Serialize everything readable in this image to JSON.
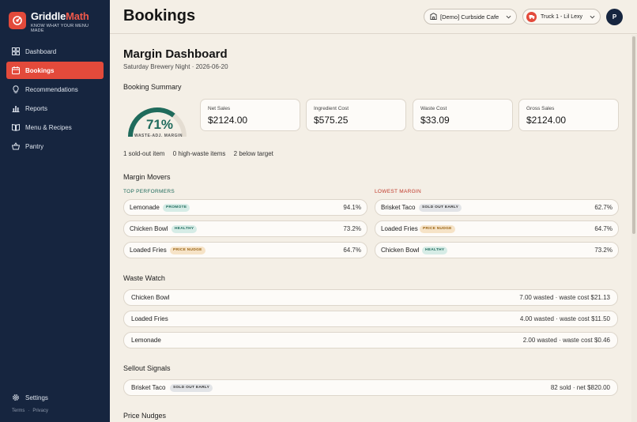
{
  "brand": {
    "name_part1": "Griddle",
    "name_part2": "Math",
    "tagline": "KNOW WHAT YOUR MENU MADE",
    "accent_color": "#e34a3b",
    "sidebar_color": "#16253f"
  },
  "sidebar": {
    "items": [
      {
        "label": "Dashboard",
        "icon": "grid-icon"
      },
      {
        "label": "Bookings",
        "icon": "calendar-icon",
        "active": true
      },
      {
        "label": "Recommendations",
        "icon": "lightbulb-icon"
      },
      {
        "label": "Reports",
        "icon": "bar-chart-icon"
      },
      {
        "label": "Menu & Recipes",
        "icon": "book-icon"
      },
      {
        "label": "Pantry",
        "icon": "basket-icon"
      }
    ],
    "settings_label": "Settings",
    "legal": {
      "terms": "Terms",
      "separator": "·",
      "privacy": "Privacy"
    }
  },
  "header": {
    "title": "Bookings",
    "location": "[Demo] Curbside Cafe",
    "truck": "Truck 1 - Lil Lexy",
    "avatar_initial": "P"
  },
  "dashboard": {
    "title": "Margin Dashboard",
    "subtitle": "Saturday Brewery Night · 2026-06-20",
    "booking_summary_title": "Booking Summary",
    "gauge": {
      "value_text": "71%",
      "value": 0.71,
      "label": "WASTE-ADJ. MARGIN",
      "color": "#1f6b5c"
    },
    "metrics": [
      {
        "label": "Net Sales",
        "value": "$2124.00"
      },
      {
        "label": "Ingredient Cost",
        "value": "$575.25"
      },
      {
        "label": "Waste Cost",
        "value": "$33.09"
      },
      {
        "label": "Gross Sales",
        "value": "$2124.00"
      }
    ],
    "stats": [
      "1 sold-out item",
      "0 high-waste items",
      "2 below target"
    ]
  },
  "movers": {
    "title": "Margin Movers",
    "top_label": "TOP PERFORMERS",
    "low_label": "LOWEST MARGIN",
    "top": [
      {
        "name": "Lemonade",
        "badge": "PROMOTE",
        "value": "94.1%"
      },
      {
        "name": "Chicken Bowl",
        "badge": "HEALTHY",
        "value": "73.2%"
      },
      {
        "name": "Loaded Fries",
        "badge": "PRICE NUDGE",
        "value": "64.7%"
      }
    ],
    "low": [
      {
        "name": "Brisket Taco",
        "badge": "SOLD OUT EARLY",
        "value": "62.7%"
      },
      {
        "name": "Loaded Fries",
        "badge": "PRICE NUDGE",
        "value": "64.7%"
      },
      {
        "name": "Chicken Bowl",
        "badge": "HEALTHY",
        "value": "73.2%"
      }
    ]
  },
  "waste": {
    "title": "Waste Watch",
    "rows": [
      {
        "name": "Chicken Bowl",
        "value": "7.00 wasted · waste cost $21.13"
      },
      {
        "name": "Loaded Fries",
        "value": "4.00 wasted · waste cost $11.50"
      },
      {
        "name": "Lemonade",
        "value": "2.00 wasted · waste cost $0.46"
      }
    ]
  },
  "sellout": {
    "title": "Sellout Signals",
    "rows": [
      {
        "name": "Brisket Taco",
        "badge": "SOLD OUT EARLY",
        "value": "82 sold · net $820.00"
      }
    ]
  },
  "price_nudges": {
    "title": "Price Nudges"
  }
}
